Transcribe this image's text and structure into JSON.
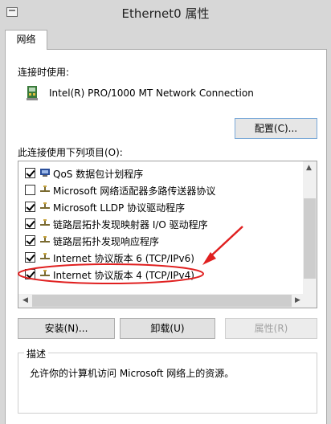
{
  "window": {
    "title": "Ethernet0 属性"
  },
  "tabs": [
    {
      "label": "网络"
    }
  ],
  "connect_using": {
    "label": "连接时使用:",
    "adapter": "Intel(R) PRO/1000 MT Network Connection",
    "configure_button": "配置(C)..."
  },
  "items_section": {
    "label": "此连接使用下列项目(O):",
    "items": [
      {
        "label": "QoS 数据包计划程序",
        "checked": true,
        "icon": "qos-icon"
      },
      {
        "label": "Microsoft 网络适配器多路传送器协议",
        "checked": false,
        "icon": "protocol-icon"
      },
      {
        "label": "Microsoft LLDP 协议驱动程序",
        "checked": true,
        "icon": "protocol-icon"
      },
      {
        "label": "链路层拓扑发现映射器 I/O 驱动程序",
        "checked": true,
        "icon": "protocol-icon"
      },
      {
        "label": "链路层拓扑发现响应程序",
        "checked": true,
        "icon": "protocol-icon"
      },
      {
        "label": "Internet 协议版本 6 (TCP/IPv6)",
        "checked": true,
        "icon": "protocol-icon"
      },
      {
        "label": "Internet 协议版本 4 (TCP/IPv4)",
        "checked": true,
        "icon": "protocol-icon"
      }
    ]
  },
  "buttons": {
    "install": "安装(N)...",
    "uninstall": "卸载(U)",
    "properties": "属性(R)"
  },
  "description": {
    "title": "描述",
    "text": "允许你的计算机访问 Microsoft 网络上的资源。"
  },
  "annotation_color": "#e02020"
}
